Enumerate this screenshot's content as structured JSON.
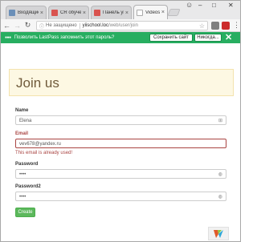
{
  "tabs": [
    {
      "title": "Входящие - vel",
      "icon": "inbox-icon",
      "color": "#6b8fb8",
      "active": false
    },
    {
      "title": "CR обучение",
      "icon": "document-icon",
      "color": "#d9534f",
      "active": false
    },
    {
      "title": "Панель упра",
      "icon": "document-icon",
      "color": "#d9534f",
      "active": false
    },
    {
      "title": "Videoschool",
      "icon": "page-icon",
      "color": "#bbbbbb",
      "active": true
    }
  ],
  "address_bar": {
    "security_text": "Не защищено",
    "url_host": "yiischool.loc",
    "url_path": "/web/user/join"
  },
  "lastpass": {
    "prompt": "Позволить LastPass запомнить этот пароль?",
    "save_label": "Сохранить сайт",
    "never_label": "Никогда...",
    "close_glyph": "✕"
  },
  "page": {
    "heading": "Join us",
    "fields": {
      "name": {
        "label": "Name",
        "value": "Elena"
      },
      "email": {
        "label": "Email",
        "value": "vev678@yandex.ru",
        "error": "This email is already used!"
      },
      "password": {
        "label": "Password",
        "value": "••••"
      },
      "password2": {
        "label": "Password2",
        "value": "••••"
      }
    },
    "submit_label": "Create"
  },
  "colors": {
    "lastpass_green": "#27ae60",
    "error_red": "#a94442",
    "create_green": "#5cb85c",
    "jumbotron_bg": "#fdf8e3"
  }
}
